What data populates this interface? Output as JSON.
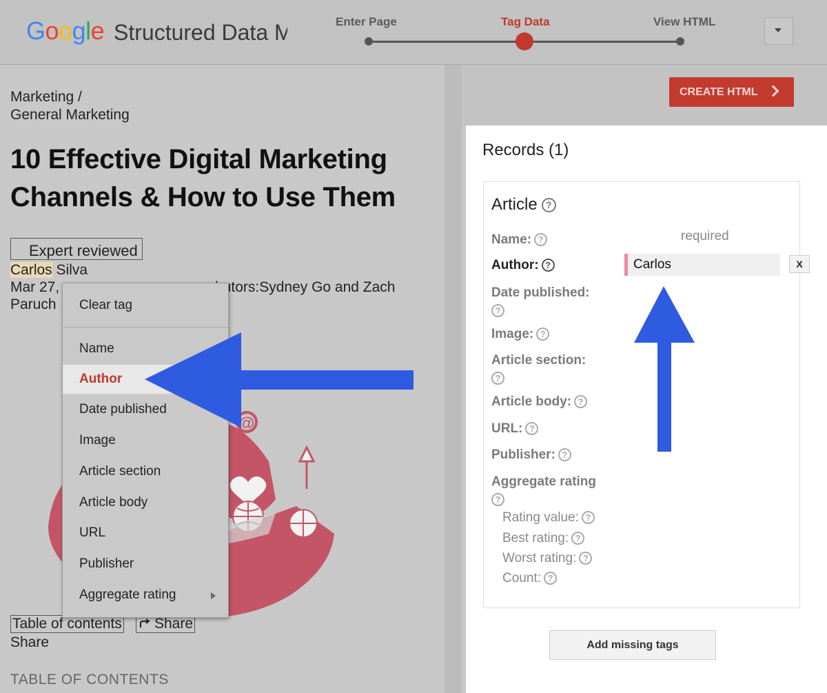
{
  "header": {
    "logo_text": "Google",
    "product_name": "Structured Data Markup Helper",
    "steps": [
      {
        "label": "Enter Page"
      },
      {
        "label": "Tag Data"
      },
      {
        "label": "View HTML"
      }
    ],
    "active_step": "Tag Data"
  },
  "article": {
    "breadcrumb_line1": "Marketing /",
    "breadcrumb_line2": "General Marketing",
    "title_line1": "10 Effective Digital Marketing",
    "title_line2": "Channels & How to Use Them",
    "badge": "Expert reviewed",
    "author_first": "Carlos",
    "author_last": " Silva",
    "date_prefix": "Mar 27,",
    "contributors_fragment": "butors:Sydney Go and Zach",
    "contributors_line2": "Paruch",
    "toc_button": "Table of contents",
    "share_button": "Share",
    "share_text": "Share",
    "toc_heading": "TABLE OF CONTENTS"
  },
  "context_menu": {
    "clear": "Clear tag",
    "items": [
      "Name",
      "Author",
      "Date published",
      "Image",
      "Article section",
      "Article body",
      "URL",
      "Publisher",
      "Aggregate rating"
    ],
    "selected": "Author"
  },
  "panel": {
    "create_button": "CREATE HTML",
    "records_title": "Records (1)",
    "card_title": "Article",
    "required_label": "required",
    "fields": {
      "name": "Name:",
      "author": "Author:",
      "date_published": "Date published:",
      "image": "Image:",
      "article_section": "Article section:",
      "article_body": "Article body:",
      "url": "URL:",
      "publisher": "Publisher:",
      "aggregate_rating": "Aggregate rating",
      "rating_value": "Rating value:",
      "best_rating": "Best rating:",
      "worst_rating": "Worst rating:",
      "count": "Count:"
    },
    "author_value": "Carlos",
    "remove_button": "X",
    "add_missing_button": "Add missing tags",
    "help_glyph": "?"
  },
  "colors": {
    "accent_red": "#c0392b",
    "annotation_blue": "#2f5be0",
    "illustration_red": "#c45566",
    "author_marker": "#e98aa5"
  }
}
